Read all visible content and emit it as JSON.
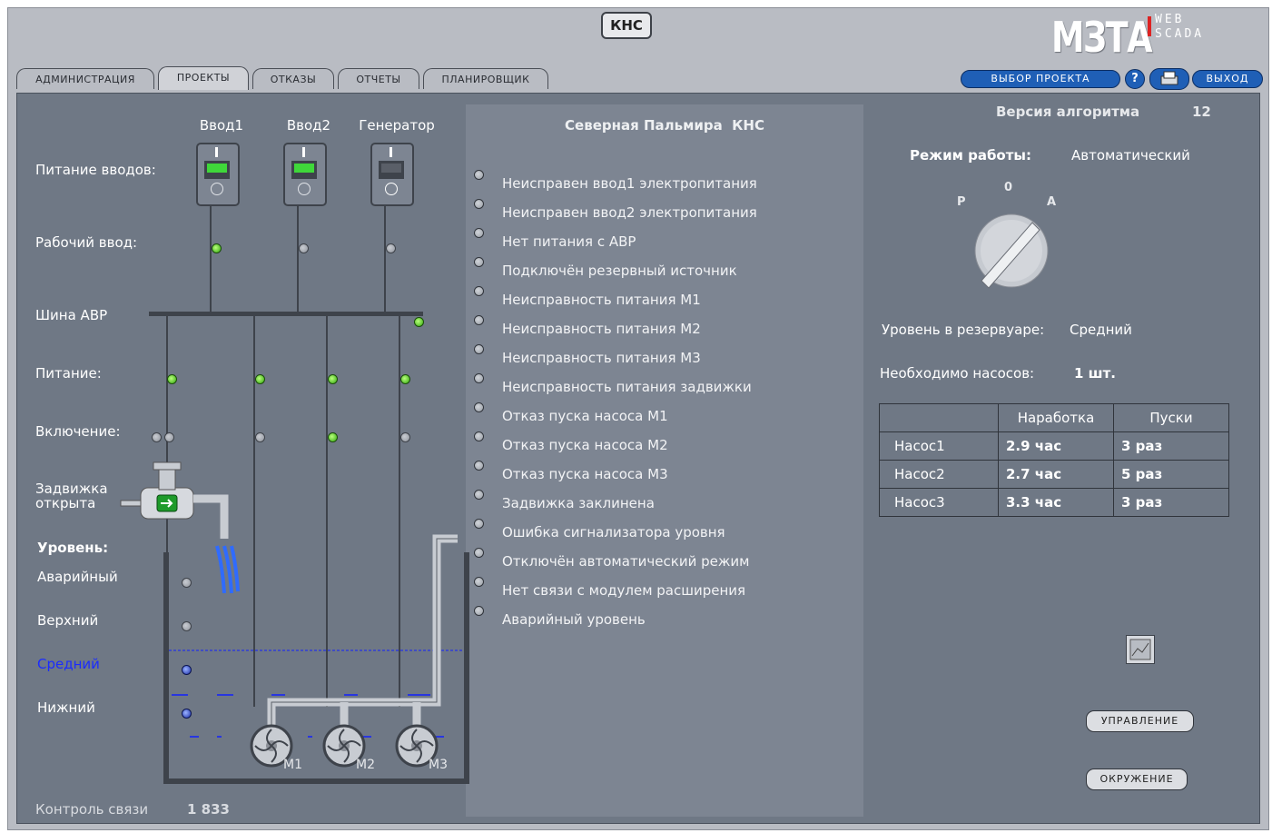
{
  "app": {
    "title": "КНС",
    "logo_text": "МЗТА",
    "logo_sub1": "WEB",
    "logo_sub2": "SCADA"
  },
  "tabs": [
    "АДМИНИСТРАЦИЯ",
    "ПРОЕКТЫ",
    "ОТКАЗЫ",
    "ОТЧЕТЫ",
    "ПЛАНИРОВЩИК"
  ],
  "active_tab": "ПРОЕКТЫ",
  "header_buttons": {
    "project_select": "ВЫБОР ПРОЕКТА",
    "help": "?",
    "exit": "ВЫХОД"
  },
  "power": {
    "inputs": [
      "Ввод1",
      "Ввод2",
      "Генератор"
    ],
    "input_states": [
      "on",
      "on",
      "off"
    ],
    "switch_on_mark": "I",
    "switch_off_mark": "O",
    "labels": {
      "power_inputs": "Питание вводов:",
      "working_input": "Рабочий ввод:",
      "bus": "Шина АВР",
      "supply": "Питание:",
      "enable": "Включение:",
      "valve_line1": "Задвижка",
      "valve_line2": "открыта",
      "level": "Уровень:"
    },
    "working_input_leds": [
      "on",
      "off",
      "off"
    ],
    "bus_led": "on",
    "supply_leds": [
      "on",
      "on",
      "on",
      "on"
    ],
    "enable_leds": [
      "off",
      "off",
      "off",
      "on",
      "off"
    ]
  },
  "levels": {
    "items": [
      "Аварийный",
      "Верхний",
      "Средний",
      "Нижний"
    ],
    "current": "Средний",
    "leds": [
      "off",
      "off",
      "blue",
      "blue"
    ]
  },
  "pump_labels": [
    "М1",
    "М2",
    "М3"
  ],
  "link_control": {
    "label": "Контроль связи",
    "value": "1 833"
  },
  "alarms": {
    "title": "Северная Пальмира  КНС",
    "items": [
      "Неисправен ввод1 электропитания",
      "Неисправен ввод2 электропитания",
      "Нет питания с АВР",
      "Подключён резервный источник",
      "Неисправность питания М1",
      "Неисправность питания М2",
      "Неисправность питания М3",
      "Неисправность питания задвижки",
      "Отказ пуска насоса М1",
      "Отказ пуска насоса М2",
      "Отказ пуска насоса М3",
      "Задвижка заклинена",
      "Ошибка сигнализатора уровня",
      "Отключён автоматический режим",
      "Нет связи с модулем расширения",
      "Аварийный уровень"
    ]
  },
  "right": {
    "algo_label": "Версия алгоритма",
    "algo_version": "12",
    "mode_label": "Режим работы:",
    "mode_value": "Автоматический",
    "knob_labels": {
      "p": "Р",
      "o": "0",
      "a": "А"
    },
    "reservoir_label": "Уровень в резервуаре:",
    "reservoir_value": "Средний",
    "pumps_needed_label": "Необходимо насосов:",
    "pumps_needed_value": "1 шт."
  },
  "pump_table": {
    "headers": [
      "",
      "Наработка",
      "Пуски"
    ],
    "rows": [
      [
        "Насос1",
        "2.9 час",
        "3 раз"
      ],
      [
        "Насос2",
        "2.7 час",
        "5 раз"
      ],
      [
        "Насос3",
        "3.3 час",
        "3 раз"
      ]
    ]
  },
  "buttons": {
    "control": "УПРАВЛЕНИЕ",
    "environment": "ОКРУЖЕНИЕ"
  },
  "colors": {
    "panel": "#6f7885",
    "led_on": "#2fa50c",
    "led_blue": "#1b2fa8",
    "level_line": "#1020ff",
    "pill": "#1f5fb6"
  }
}
